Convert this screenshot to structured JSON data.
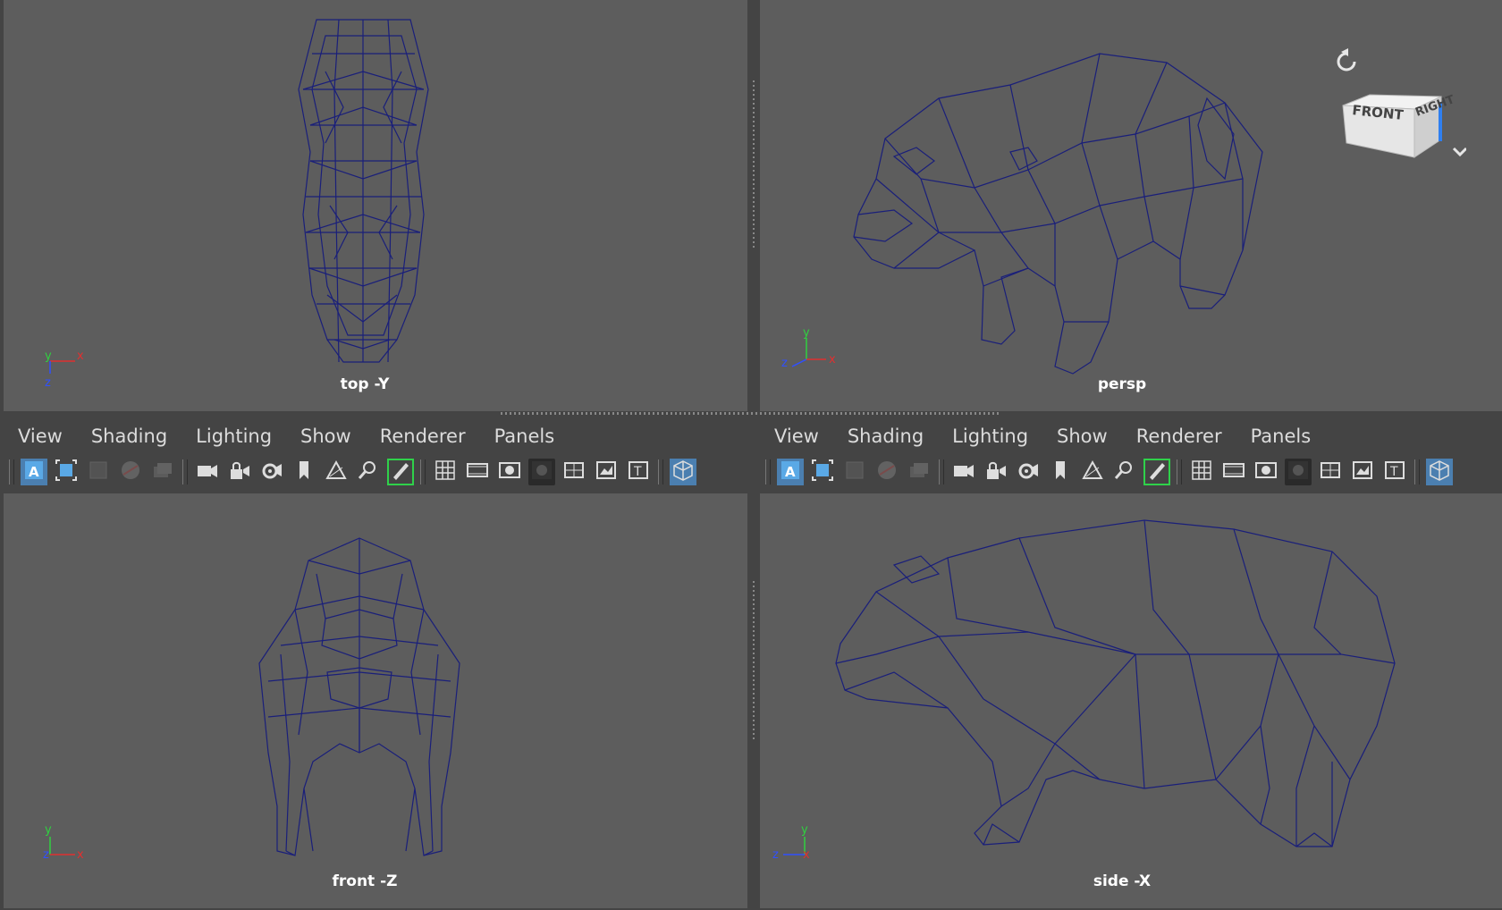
{
  "viewports": {
    "top": {
      "label": "top -Y",
      "axes": {
        "a1": "y",
        "a2": "x",
        "a3": "z"
      }
    },
    "persp": {
      "label": "persp",
      "axes": {
        "a1": "y",
        "a2": "x",
        "a3": "z"
      }
    },
    "front": {
      "label": "front -Z",
      "axes": {
        "a1": "y",
        "a2": "x",
        "a3": "z"
      }
    },
    "side": {
      "label": "side -X",
      "axes": {
        "a1": "y",
        "a2": "x",
        "a3": "z"
      }
    }
  },
  "panel_menu": {
    "view": "View",
    "shading": "Shading",
    "lighting": "Lighting",
    "show": "Show",
    "renderer": "Renderer",
    "panels": "Panels"
  },
  "viewcube": {
    "front": "FRONT",
    "right": "RIGHT"
  },
  "colors": {
    "viewport_bg": "#5d5d5d",
    "wireframe": "#1a1f7a",
    "axis_x": "#e03030",
    "axis_y": "#30d040",
    "axis_z": "#3050ff",
    "ui_bg": "#444444"
  },
  "icons": [
    "select-all-icon",
    "frame-selection-icon",
    "frame-all-icon",
    "shaded-ball-icon",
    "layers-icon",
    "camera-icon",
    "lock-camera-icon",
    "camera-attributes-icon",
    "bookmark-icon",
    "image-plane-icon",
    "2d-pan-zoom-icon",
    "grease-pencil-icon",
    "grid-icon",
    "film-gate-icon",
    "resolution-gate-icon",
    "gate-mask-icon",
    "field-chart-icon",
    "safe-action-icon",
    "safe-title-icon",
    "viewcube-toggle-icon"
  ]
}
